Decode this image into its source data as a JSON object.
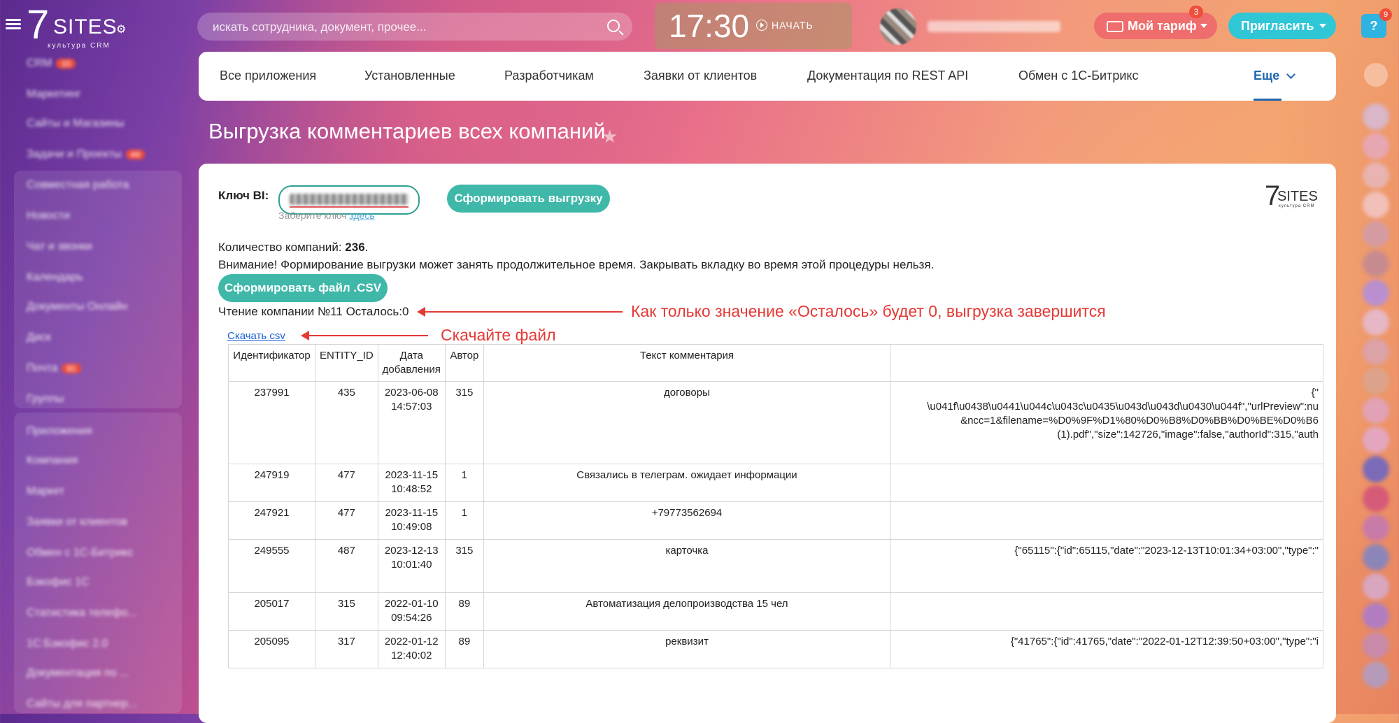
{
  "header": {
    "logo_main": "SITES",
    "logo_tag": "культура CRM",
    "search_placeholder": "искать сотрудника, документ, прочее...",
    "clock_time": "17:30",
    "clock_action": "НАЧАТЬ",
    "tariff_label": "Мой тариф",
    "tariff_count": "3",
    "invite_label": "Пригласить",
    "help_label": "?",
    "help_count": "9"
  },
  "sidebar": {
    "items": [
      {
        "label": "CRM",
        "badge": "10"
      },
      {
        "label": "Маркетинг"
      },
      {
        "label": "Сайты и Магазины"
      },
      {
        "label": "Задачи и Проекты",
        "badge": "44"
      },
      {
        "label": "Совместная работа"
      },
      {
        "label": "Новости"
      },
      {
        "label": "Чат и звонки"
      },
      {
        "label": "Календарь"
      },
      {
        "label": "Документы Онлайн"
      },
      {
        "label": "Диск"
      },
      {
        "label": "Почта",
        "badge": "81"
      },
      {
        "label": "Группы"
      },
      {
        "label": "Приложения"
      },
      {
        "label": "Компания"
      },
      {
        "label": "Маркет"
      },
      {
        "label": "Заявки от клиентов"
      },
      {
        "label": "Обмен с 1С-Битрикс"
      },
      {
        "label": "Бэкофис 1С"
      },
      {
        "label": "Статистика телефо..."
      },
      {
        "label": "1С:Бэкофис 2.0"
      },
      {
        "label": "Документация по ..."
      },
      {
        "label": "Сайты для партнер..."
      }
    ]
  },
  "nav": {
    "tabs": [
      {
        "label": "Все приложения"
      },
      {
        "label": "Установленные"
      },
      {
        "label": "Разработчикам"
      },
      {
        "label": "Заявки от клиентов"
      },
      {
        "label": "Документация по REST API"
      },
      {
        "label": "Обмен с 1С-Битрикс"
      },
      {
        "label": "Еще"
      }
    ]
  },
  "page": {
    "title": "Выгрузка комментариев всех компаний",
    "bi_label": "Ключ BI:",
    "form_button": "Сформировать выгрузку",
    "hint_text": "Заберите ключ ",
    "hint_link": "здесь",
    "card_logo_main": "SITES",
    "card_logo_tag": "культура CRM",
    "companies_label": "Количество компаний: ",
    "companies_count": "236",
    "companies_dot": ".",
    "warning": "Внимание! Формирование выгрузки может занять продолжительное время. Закрывать вкладку во время этой процедуры нельзя.",
    "csv_button": "Сформировать файл .CSV",
    "reading_status": "Чтение компании №11 Осталось:0",
    "download_link": "Скачать csv"
  },
  "annotations": {
    "remaining": "Как только значение «Осталось» будет 0, выгрузка завершится",
    "download": "Скачайте файл",
    "color": "#e53935"
  },
  "table": {
    "headers": [
      "Идентификатор",
      "ENTITY_ID",
      "Дата добавления",
      "Автор",
      "Текст комментария",
      ""
    ],
    "rows": [
      {
        "id": "237991",
        "entity": "435",
        "date": "2023-06-08 14:57:03",
        "author": "315",
        "text": "договоры",
        "json": [
          "{\"",
          "\\u041f\\u0438\\u0441\\u044c\\u043c\\u0435\\u043d\\u043d\\u0430\\u044f\",\"urlPreview\":nu",
          "&ncc=1&filename=%D0%9F%D1%80%D0%B8%D0%BB%D0%BE%D0%B6",
          "(1).pdf\",\"size\":142726,\"image\":false,\"authorId\":315,\"auth"
        ]
      },
      {
        "id": "247919",
        "entity": "477",
        "date": "2023-11-15 10:48:52",
        "author": "1",
        "text": "Связались в телеграм. ожидает информации",
        "json": []
      },
      {
        "id": "247921",
        "entity": "477",
        "date": "2023-11-15 10:49:08",
        "author": "1",
        "text": "+79773562694",
        "json": []
      },
      {
        "id": "249555",
        "entity": "487",
        "date": "2023-12-13 10:01:40",
        "author": "315",
        "text": "карточка",
        "json": [
          "{\"65115\":{\"id\":65115,\"date\":\"2023-12-13T10:01:34+03:00\",\"type\":\""
        ]
      },
      {
        "id": "205017",
        "entity": "315",
        "date": "2022-01-10 09:54:26",
        "author": "89",
        "text": "Автоматизация делопроизводства 15 чел",
        "json": []
      },
      {
        "id": "205095",
        "entity": "317",
        "date": "2022-01-12 12:40:02",
        "author": "89",
        "text": "реквизит",
        "json": [
          "{\"41765\":{\"id\":41765,\"date\":\"2022-01-12T12:39:50+03:00\",\"type\":\"i"
        ]
      }
    ]
  }
}
